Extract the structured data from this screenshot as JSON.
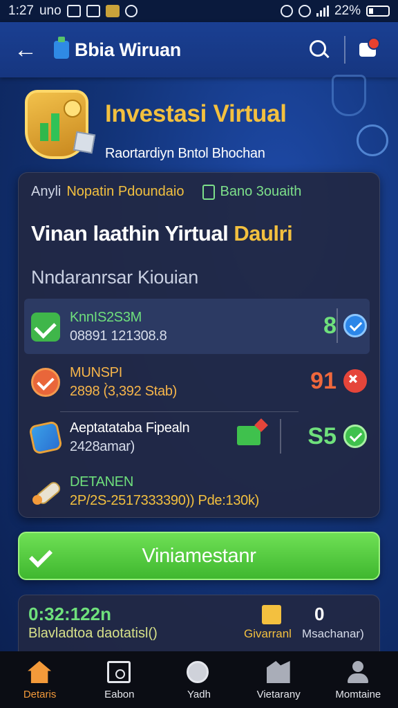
{
  "status_bar": {
    "time": "1:27",
    "carrier": "uno",
    "battery": "22%"
  },
  "app_bar": {
    "title": "Bbia Wiruan",
    "icons": [
      "back-arrow-icon",
      "app-logo-icon",
      "search-icon",
      "notification-icon"
    ]
  },
  "hero": {
    "title": "Investasi Virtual",
    "subtitle": "Raortardiyn Bntol Bhochan"
  },
  "card": {
    "tab_muted": "Anyli",
    "tab_active": "Nopatin Pdoundaio",
    "tab_green": "Bano 3ouaith",
    "title_main": "Vinan laathin Yirtual ",
    "title_highlight": "Daulri",
    "subtitle": "Nndaranrsar Kiouian",
    "rows": [
      {
        "line1": "KnnIS2S3M",
        "line2": "08891 121308.8",
        "value": "8",
        "icon": "check-green-icon",
        "badge": "check-badge-blue"
      },
      {
        "line1": "MUNSPI",
        "line2": "2898 (̀3,392 Stab)",
        "value": "91",
        "icon": "check-orange-icon",
        "badge": "close-badge-red"
      },
      {
        "line1": "Aeptatataba Fipealn",
        "line2": "2428amar)",
        "value": "S5",
        "icon": "box-icon",
        "badge": "check-badge-green"
      },
      {
        "line1": "DETANEN",
        "line2": "2P/2S-2517333390)) Pde:130k)",
        "value": "",
        "icon": "rocket-icon",
        "badge": ""
      }
    ]
  },
  "cta": {
    "label": "Viniamestanr"
  },
  "bottom_card": {
    "timer": "0:32:122n",
    "description": "Blavladtoa daotatisl()",
    "label1": "Givarranl",
    "count": "0",
    "label2": "Msachanar)"
  },
  "nav": {
    "items": [
      {
        "label": "Detaris",
        "icon": "home-icon",
        "active": true
      },
      {
        "label": "Eabon",
        "icon": "box-icon",
        "active": false
      },
      {
        "label": "Yadh",
        "icon": "clock-icon",
        "active": false
      },
      {
        "label": "Vietarany",
        "icon": "chart-icon",
        "active": false
      },
      {
        "label": "Momtaine",
        "icon": "user-icon",
        "active": false
      }
    ]
  },
  "colors": {
    "accent_gold": "#f3c03f",
    "accent_green": "#3fb72f",
    "background": "#123377"
  }
}
